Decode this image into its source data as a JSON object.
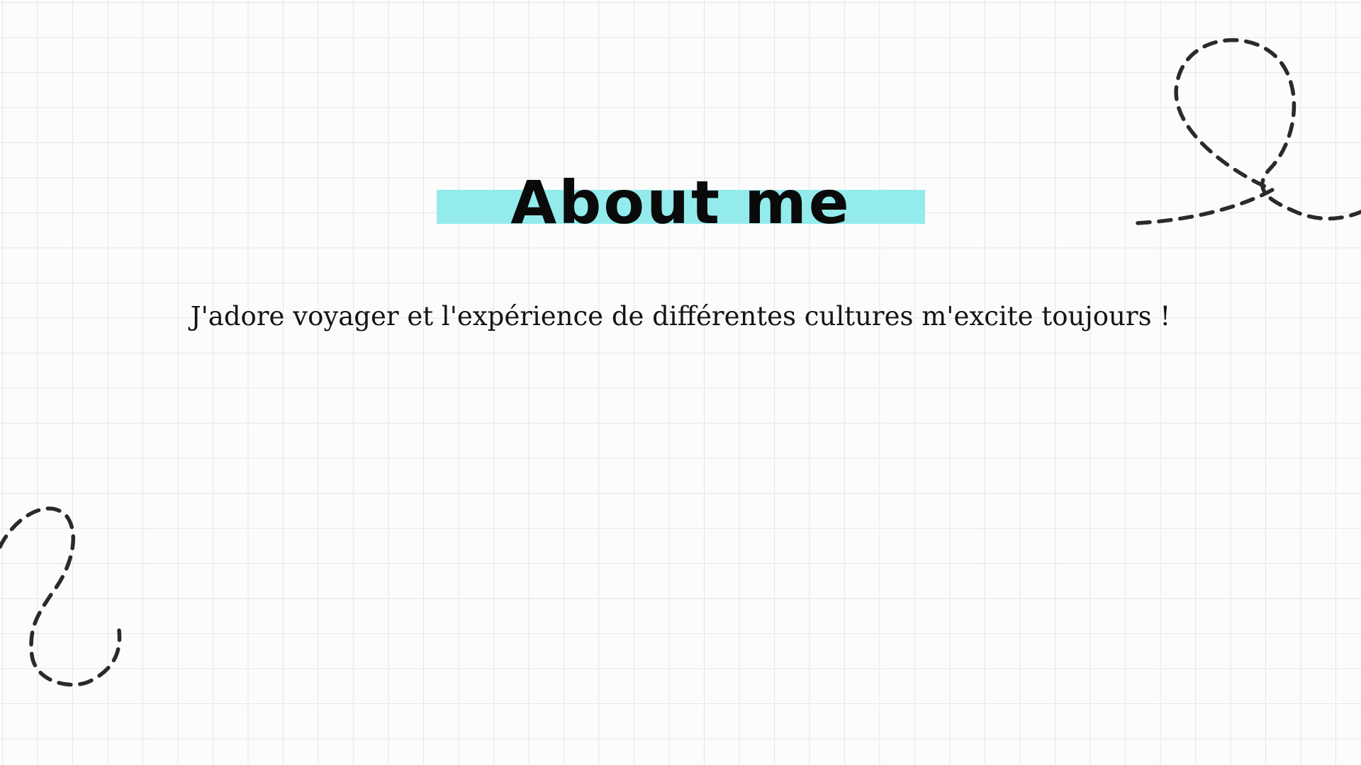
{
  "slide": {
    "title": "About me",
    "body": "J'adore voyager et l'expérience de différentes cultures m'excite toujours !"
  },
  "colors": {
    "background": "#fcfcfc",
    "grid": "#e6e6e6",
    "title_highlight": "#93ebec",
    "text": "#111111",
    "doodle_stroke": "#2a2a2a"
  }
}
